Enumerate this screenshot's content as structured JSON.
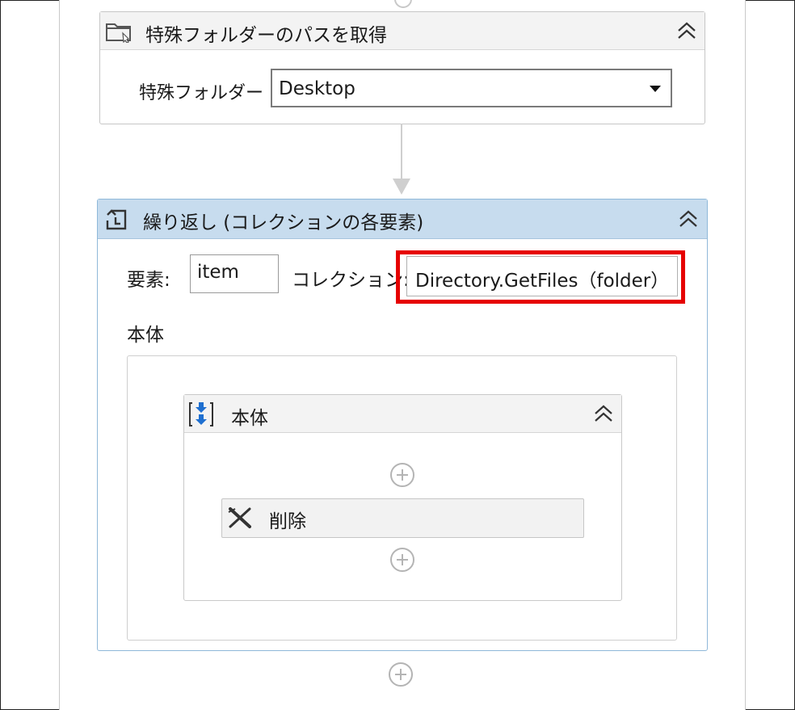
{
  "get_folder_activity": {
    "title": "特殊フォルダーのパスを取得",
    "field_label": "特殊フォルダー",
    "field_value": "Desktop",
    "icon": "folder-icon"
  },
  "foreach_activity": {
    "title": "繰り返し (コレクションの各要素)",
    "element_label": "要素:",
    "element_value": "item",
    "collection_label": "コレクション:",
    "collection_value": "Directory.GetFiles（folder）",
    "body_label": "本体",
    "icon": "loop-icon",
    "highlight_color": "#e60000"
  },
  "sequence": {
    "title": "本体",
    "icon": "sequence-icon"
  },
  "delete_activity": {
    "title": "削除",
    "icon": "delete-x-icon"
  }
}
